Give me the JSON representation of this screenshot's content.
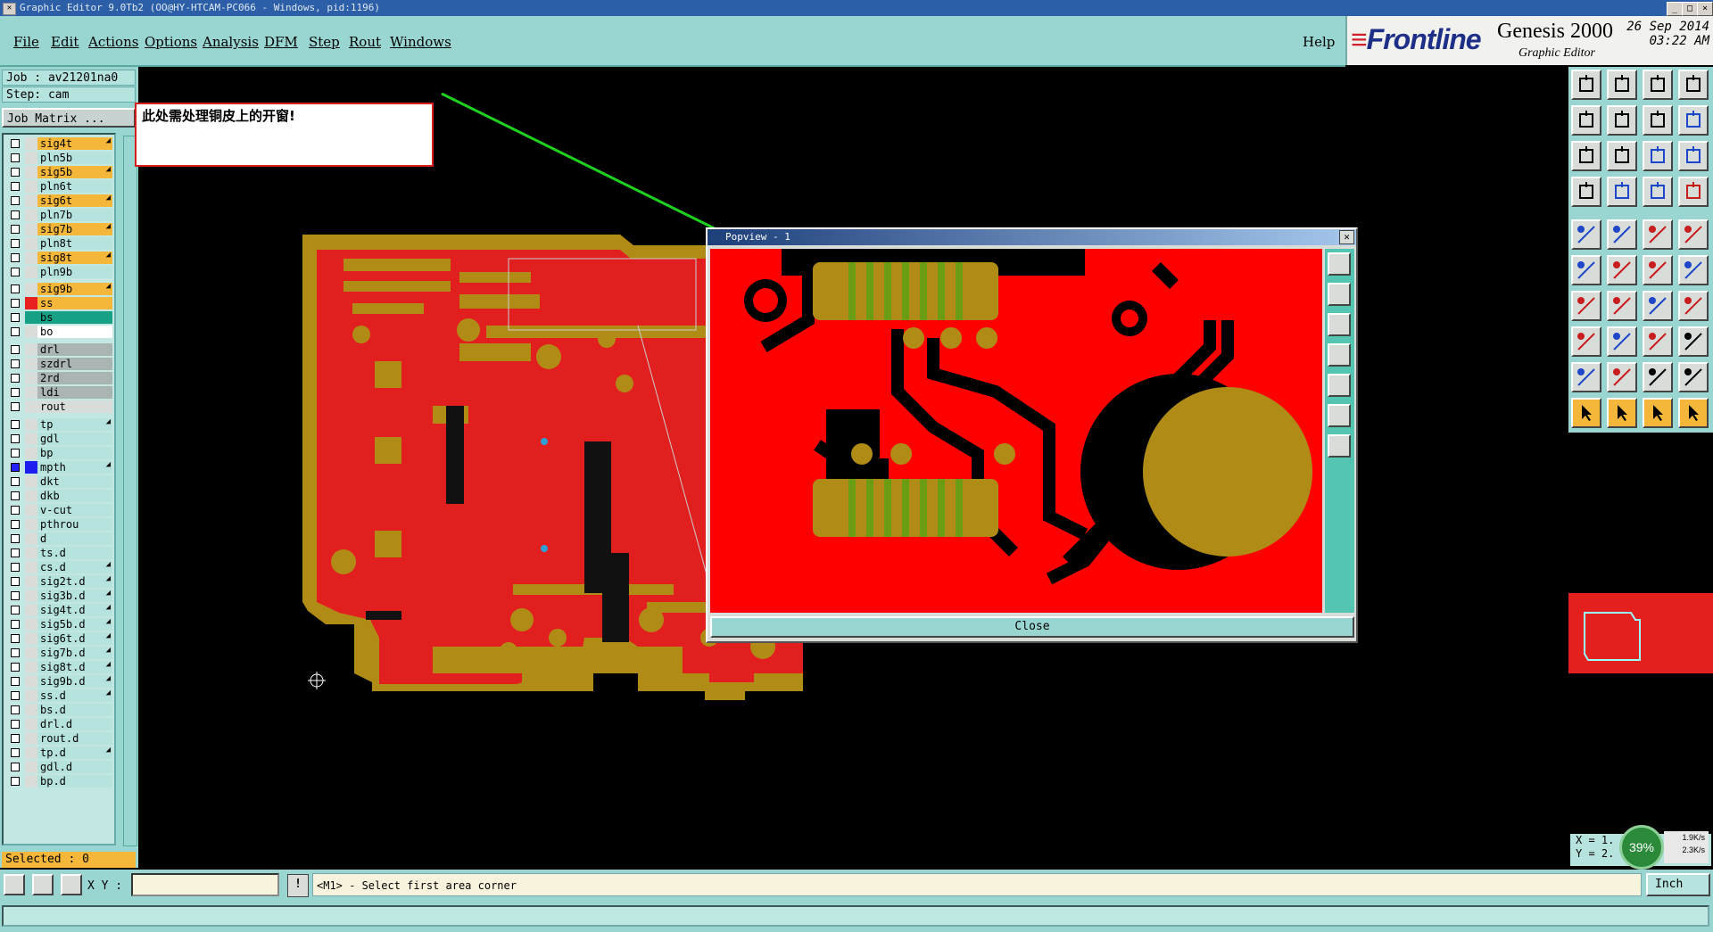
{
  "title_bar": {
    "text": "Graphic Editor 9.0Tb2 (OO@HY-HTCAM-PC066 - Windows, pid:1196)",
    "min": "_",
    "max": "□",
    "close": "×"
  },
  "menu": [
    "File",
    "Edit",
    "Actions",
    "Options",
    "Analysis",
    "DFM",
    "Step",
    "Rout",
    "Windows"
  ],
  "help": "Help",
  "brand": {
    "logo": "Frontline",
    "product": "Genesis 2000",
    "subtitle": "Graphic Editor",
    "date": "26 Sep 2014",
    "time": "03:22 AM"
  },
  "job": {
    "job_label": "Job : av21201na0",
    "step_label": "Step: cam",
    "matrix_button": "Job Matrix ..."
  },
  "note": "此处需处理铜皮上的开窗!",
  "layers": [
    {
      "name": "sig4t",
      "bg": "#f5b73a",
      "col": "#d8ddd9",
      "arrow": true
    },
    {
      "name": "pln5b",
      "bg": "#b6e3de",
      "col": "#d8ddd9",
      "arrow": false
    },
    {
      "name": "sig5b",
      "bg": "#f5b73a",
      "col": "#d8ddd9",
      "arrow": true
    },
    {
      "name": "pln6t",
      "bg": "#b6e3de",
      "col": "#d8ddd9",
      "arrow": false
    },
    {
      "name": "sig6t",
      "bg": "#f5b73a",
      "col": "#d8ddd9",
      "arrow": true
    },
    {
      "name": "pln7b",
      "bg": "#b6e3de",
      "col": "#d8ddd9",
      "arrow": false
    },
    {
      "name": "sig7b",
      "bg": "#f5b73a",
      "col": "#d8ddd9",
      "arrow": true
    },
    {
      "name": "pln8t",
      "bg": "#b6e3de",
      "col": "#d8ddd9",
      "arrow": false
    },
    {
      "name": "sig8t",
      "bg": "#f5b73a",
      "col": "#d8ddd9",
      "arrow": true
    },
    {
      "name": "pln9b",
      "bg": "#b6e3de",
      "col": "#d8ddd9",
      "arrow": false
    },
    {
      "name": "sig9b",
      "bg": "#f5b73a",
      "col": "#d8ddd9",
      "arrow": true
    },
    {
      "name": "ss",
      "bg": "#f5b73a",
      "col": "#e82020",
      "arrow": false
    },
    {
      "name": "bs",
      "bg": "#16a085",
      "col": "#16a085",
      "arrow": false
    },
    {
      "name": "bo",
      "bg": "#ffffff",
      "col": "#d8ddd9",
      "arrow": false
    },
    {
      "name": "drl",
      "bg": "#a9b4b3",
      "col": "#d8ddd9",
      "arrow": false
    },
    {
      "name": "szdrl",
      "bg": "#a9b4b3",
      "col": "#d8ddd9",
      "arrow": false
    },
    {
      "name": "2rd",
      "bg": "#a9b4b3",
      "col": "#d8ddd9",
      "arrow": false
    },
    {
      "name": "ldi",
      "bg": "#a9b4b3",
      "col": "#d8ddd9",
      "arrow": false
    },
    {
      "name": "rout",
      "bg": "#d8ddd9",
      "col": "#d8ddd9",
      "arrow": false
    },
    {
      "name": "tp",
      "bg": "#b6e3de",
      "col": "#d8ddd9",
      "arrow": true
    },
    {
      "name": "gdl",
      "bg": "#b6e3de",
      "col": "#d8ddd9",
      "arrow": false
    },
    {
      "name": "bp",
      "bg": "#b6e3de",
      "col": "#d8ddd9",
      "arrow": false
    },
    {
      "name": "mpth",
      "bg": "#b6e3de",
      "col": "#1d1df0",
      "arrow": true,
      "selected": true
    },
    {
      "name": "dkt",
      "bg": "#b6e3de",
      "col": "#d8ddd9",
      "arrow": false
    },
    {
      "name": "dkb",
      "bg": "#b6e3de",
      "col": "#d8ddd9",
      "arrow": false
    },
    {
      "name": "v-cut",
      "bg": "#b6e3de",
      "col": "#d8ddd9",
      "arrow": false
    },
    {
      "name": "pthrou",
      "bg": "#b6e3de",
      "col": "#d8ddd9",
      "arrow": false
    },
    {
      "name": "d",
      "bg": "#b6e3de",
      "col": "#d8ddd9",
      "arrow": false
    },
    {
      "name": "ts.d",
      "bg": "#b6e3de",
      "col": "#d8ddd9",
      "arrow": false
    },
    {
      "name": "cs.d",
      "bg": "#b6e3de",
      "col": "#d8ddd9",
      "arrow": true
    },
    {
      "name": "sig2t.d",
      "bg": "#b6e3de",
      "col": "#d8ddd9",
      "arrow": true
    },
    {
      "name": "sig3b.d",
      "bg": "#b6e3de",
      "col": "#d8ddd9",
      "arrow": true
    },
    {
      "name": "sig4t.d",
      "bg": "#b6e3de",
      "col": "#d8ddd9",
      "arrow": true
    },
    {
      "name": "sig5b.d",
      "bg": "#b6e3de",
      "col": "#d8ddd9",
      "arrow": true
    },
    {
      "name": "sig6t.d",
      "bg": "#b6e3de",
      "col": "#d8ddd9",
      "arrow": true
    },
    {
      "name": "sig7b.d",
      "bg": "#b6e3de",
      "col": "#d8ddd9",
      "arrow": true
    },
    {
      "name": "sig8t.d",
      "bg": "#b6e3de",
      "col": "#d8ddd9",
      "arrow": true
    },
    {
      "name": "sig9b.d",
      "bg": "#b6e3de",
      "col": "#d8ddd9",
      "arrow": true
    },
    {
      "name": "ss.d",
      "bg": "#b6e3de",
      "col": "#d8ddd9",
      "arrow": true
    },
    {
      "name": "bs.d",
      "bg": "#b6e3de",
      "col": "#d8ddd9",
      "arrow": false
    },
    {
      "name": "drl.d",
      "bg": "#b6e3de",
      "col": "#d8ddd9",
      "arrow": false
    },
    {
      "name": "rout.d",
      "bg": "#b6e3de",
      "col": "#d8ddd9",
      "arrow": false
    },
    {
      "name": "tp.d",
      "bg": "#b6e3de",
      "col": "#d8ddd9",
      "arrow": true
    },
    {
      "name": "gdl.d",
      "bg": "#b6e3de",
      "col": "#d8ddd9",
      "arrow": false
    },
    {
      "name": "bp.d",
      "bg": "#b6e3de",
      "col": "#d8ddd9",
      "arrow": false
    }
  ],
  "selected_count": "Selected : 0",
  "popview": {
    "title": "Popview - 1",
    "close_button": "Close"
  },
  "status": {
    "xy_label": "X Y :",
    "xy_value": "",
    "info": "!",
    "prompt": "<M1> - Select first area corner",
    "units": "Inch"
  },
  "coords": {
    "x": "X = 1.",
    "y": "Y = 2."
  },
  "net": {
    "percent": "39%",
    "up": "1.9K/s",
    "down": "2.3K/s"
  },
  "colors": {
    "board_copper": "#e21f1f",
    "board_pad": "#b08c16",
    "panel_bg": "#99d6d1",
    "selected_layer": "#f5b73a",
    "arrow": "#1fd11f"
  }
}
